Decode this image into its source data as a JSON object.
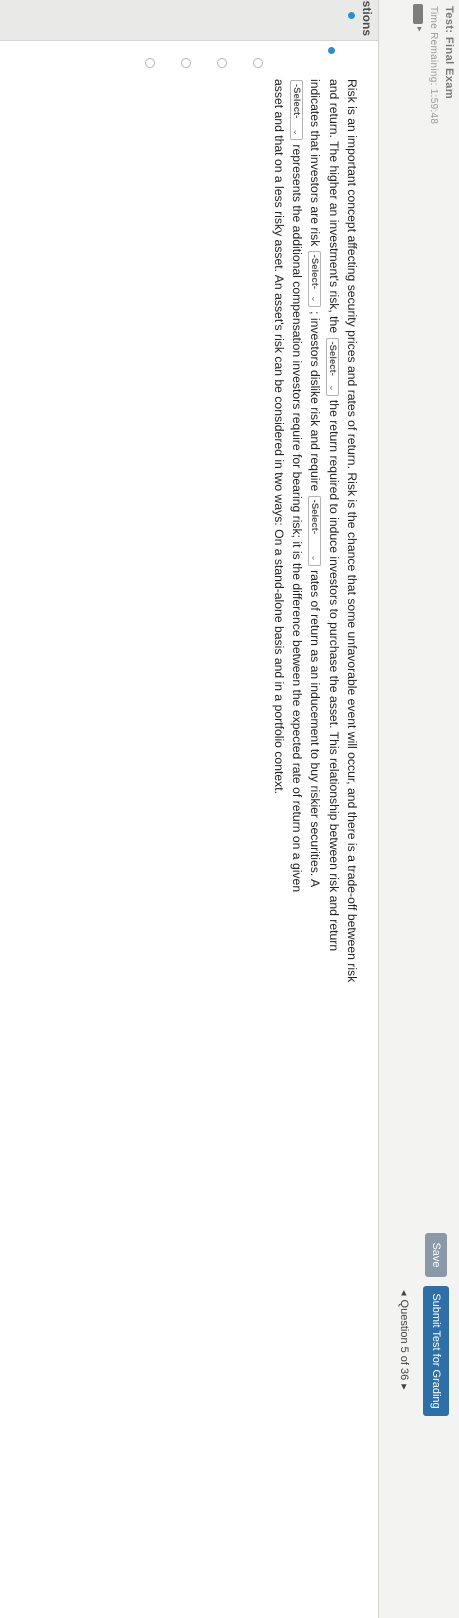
{
  "header": {
    "title": "Test: Final Exam",
    "time_remaining": "Time Remaining: 1:59:48"
  },
  "toolbar": {
    "save_label": "Save",
    "submit_label": "Submit Test for Grading"
  },
  "question_nav": {
    "prev_arrow": "◂",
    "label": "Question 5 of 36",
    "next_arrow": "▸"
  },
  "sidebar": {
    "label": "estions"
  },
  "question": {
    "lines": [
      "Risk is an important concept affecting security prices and rates of return. Risk is the chance that some unfavorable event will occur, and there is a trade-off between risk",
      "and return. The higher an investment's risk, the",
      "the return required to induce investors to purchase the asset. This relationship between risk and return",
      "indicates that investors are risk",
      "; investors dislike risk and require",
      "rates of return as an inducement to buy riskier securities. A",
      "represents the additional compensation investors require for bearing risk; it is the difference between the expected rate of return on a given",
      "asset and that on a less risky asset. An asset's risk can be considered in two ways: On a stand-alone basis and in a portfolio context."
    ],
    "select_placeholder": "-Select-",
    "select_chevron": "⌄"
  }
}
